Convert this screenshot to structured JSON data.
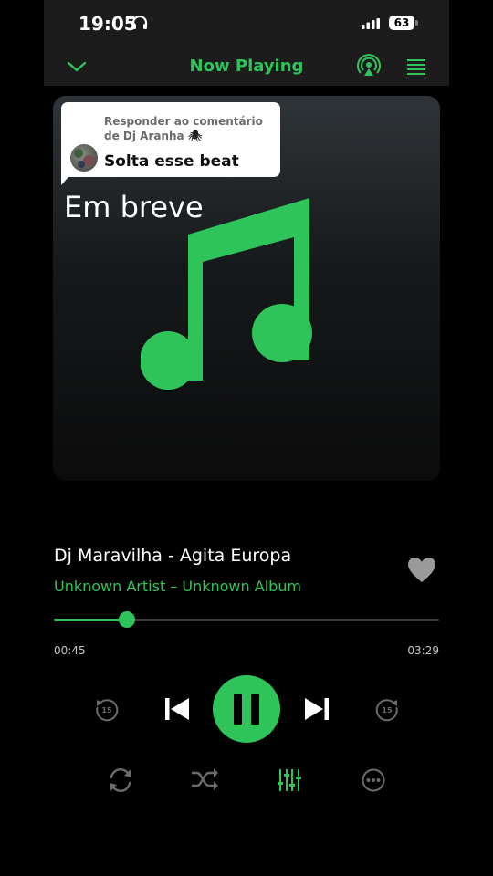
{
  "status_bar": {
    "time": "19:05",
    "battery": "63",
    "headphones_icon": "headphones-icon",
    "signal_icon": "cellular-signal-icon"
  },
  "header": {
    "title": "Now Playing",
    "collapse_icon": "chevron-down-icon",
    "airplay_icon": "airplay-icon",
    "menu_icon": "queue-menu-icon"
  },
  "artwork": {
    "caption": "Em breve",
    "note_icon": "music-note-icon",
    "reply": {
      "header": "Responder ao comentário de Dj Aranha",
      "emoji": "🕷",
      "body": "Solta esse beat"
    }
  },
  "track": {
    "title": "Dj Maravilha - Agita Europa",
    "artist_album": "Unknown Artist – Unknown Album",
    "favorite_icon": "heart-icon"
  },
  "progress": {
    "elapsed": "00:45",
    "total": "03:29",
    "fraction": 0.19
  },
  "controls": {
    "rewind_seconds": "15",
    "forward_seconds": "15",
    "icons": [
      "rewind-15-icon",
      "previous-icon",
      "pause-icon",
      "next-icon",
      "forward-15-icon"
    ],
    "secondary_icons": [
      "repeat-icon",
      "shuffle-icon",
      "equalizer-icon",
      "more-icon"
    ]
  },
  "colors": {
    "accent": "#2fc45a",
    "background": "#000000",
    "header_bg": "#1c1c1c",
    "inactive_icon": "#6b6b6b"
  }
}
